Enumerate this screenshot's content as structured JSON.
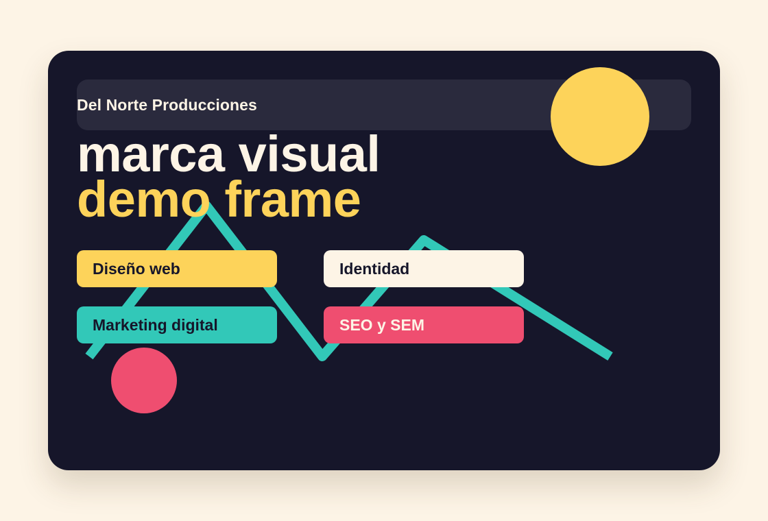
{
  "brand": {
    "name": "Del Norte Producciones"
  },
  "hero": {
    "line1": "marca visual",
    "line2": "demo frame"
  },
  "services": [
    {
      "label": "Diseño web",
      "color": "#fdd35a"
    },
    {
      "label": "Identidad",
      "color": "#fdf4e6"
    },
    {
      "label": "Marketing digital",
      "color": "#32c8b8"
    },
    {
      "label": "SEO y SEM",
      "color": "#ef4e70"
    }
  ],
  "decorations": {
    "sun_color": "#fdd35a",
    "dot_color": "#ef4e70",
    "zigzag_color": "#32c8b8"
  },
  "colors": {
    "background": "#fdf4e6",
    "card": "#16162a",
    "topbar": "#2a2a3d",
    "text_light": "#fdf4e6",
    "text_dark": "#16162a"
  }
}
